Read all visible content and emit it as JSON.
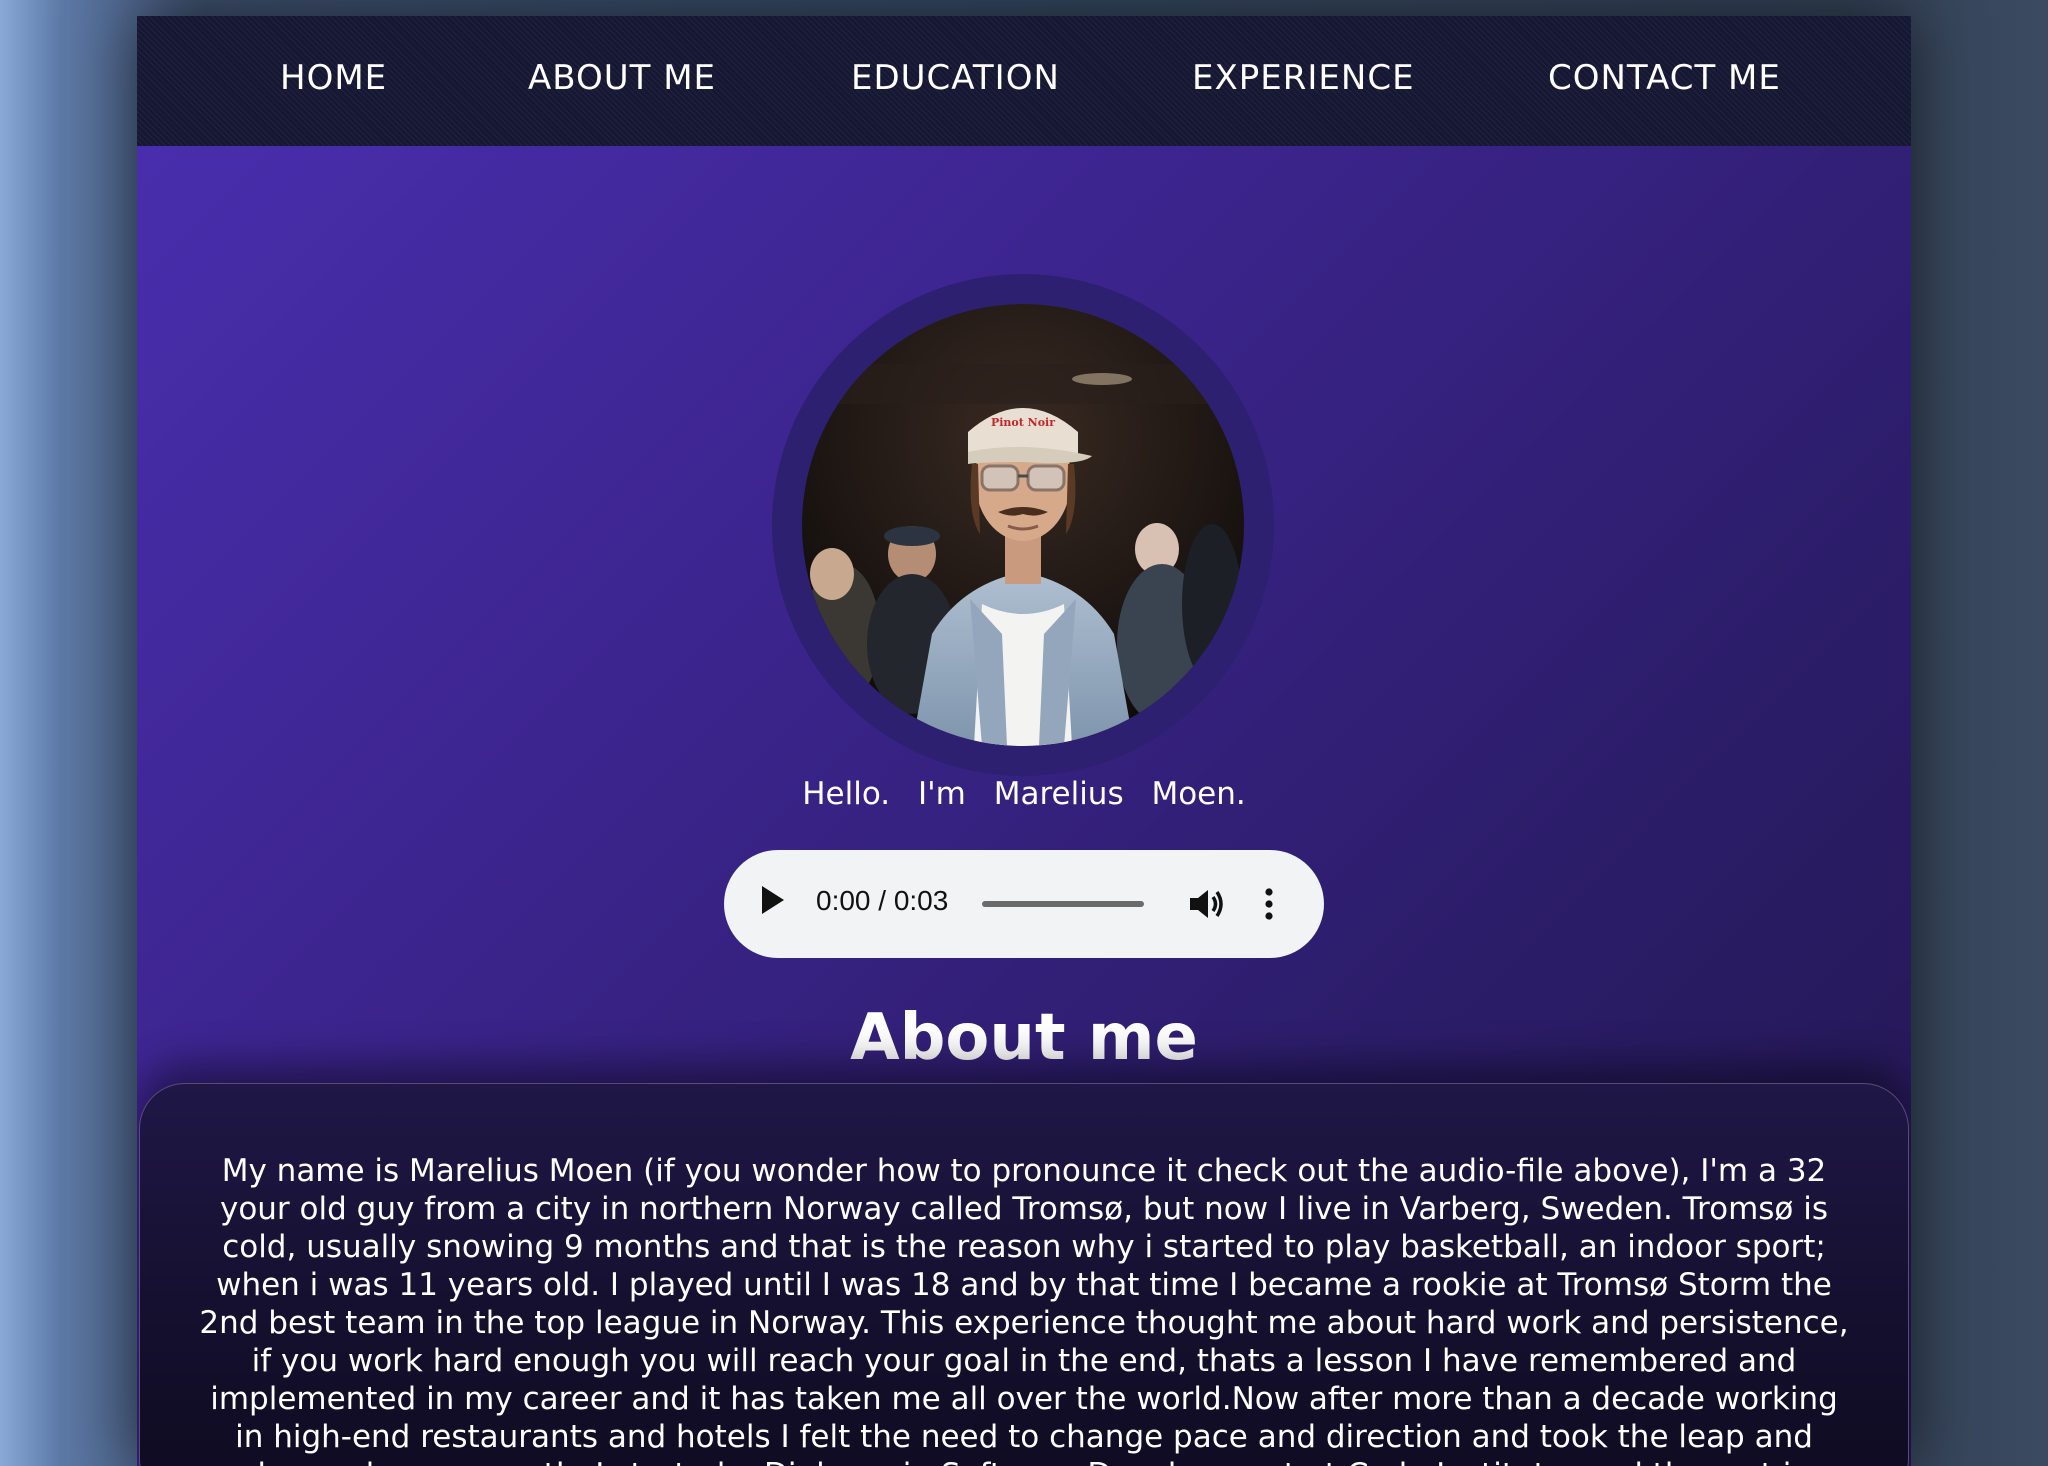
{
  "nav": {
    "items": [
      "HOME",
      "ABOUT ME",
      "EDUCATION",
      "EXPERIENCE",
      "CONTACT ME"
    ]
  },
  "hero": {
    "greeting": "Hello. I'm Marelius Moen.",
    "cap_text": "Pinot Noir"
  },
  "audio": {
    "time": "0:00 / 0:03",
    "progress": 0,
    "icons": [
      "play-icon",
      "volume-icon",
      "more-options-icon"
    ]
  },
  "about": {
    "title": "About me",
    "text": "My name is Marelius Moen (if you wonder how to pronounce it check out the audio-file above), I'm a 32 your old guy from a city in northern Norway called Tromsø, but now I live in Varberg, Sweden. Tromsø is cold, usually snowing 9 months and that is the reason why i started to play basketball, an indoor sport; when i was 11 years old. I played until I was 18 and by that time I became a rookie at Tromsø Storm the 2nd best team in the top league in Norway. This experience thought me about hard work and persistence, if you work hard enough you will reach your goal in the end, thats a lesson I have remembered and implemented in my career and it has taken me all over the world.Now after more than a decade working in high-end restaurants and hotels I felt the need to change pace and direction and took the leap and changed carreer path. I started a Diploma in Software Development at Code Institute, and the rest is history. I love the problem solving aspect of the job and to create something that is"
  },
  "colors": {
    "nav_bg": "#151733",
    "page_gradient_start": "#4a2fb0",
    "page_gradient_end": "#22174f",
    "card_bg": "#140f2c",
    "audio_bg": "#f1f3f4"
  }
}
